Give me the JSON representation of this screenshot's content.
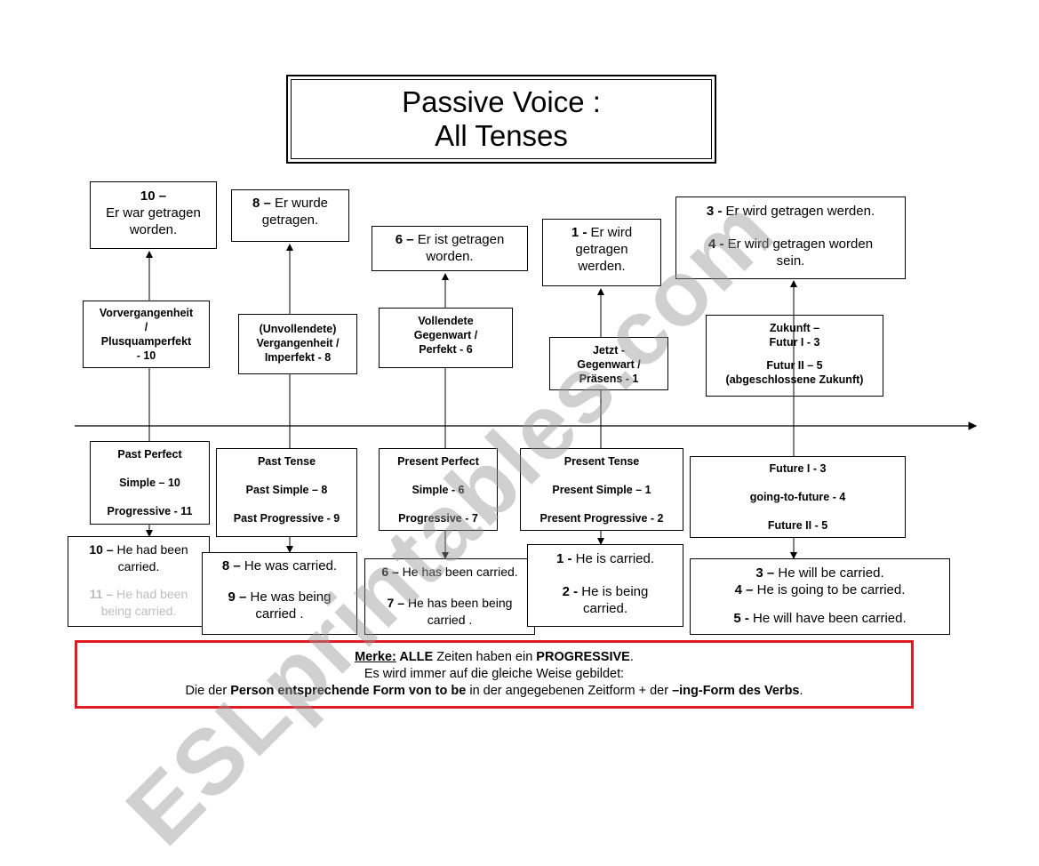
{
  "title": {
    "line1": "Passive Voice :",
    "line2": "All Tenses"
  },
  "german_examples": {
    "past_perfect": {
      "num": "10 –",
      "text1": "Er war getragen",
      "text2": "worden."
    },
    "past": {
      "num": "8 –",
      "text1": " Er wurde",
      "text2": "getragen."
    },
    "present_perfect": {
      "num": "6 –",
      "text1": " Er ist getragen",
      "text2": "worden."
    },
    "present": {
      "num": "1 -",
      "text1": " Er wird",
      "text2": "getragen",
      "text3": "werden."
    },
    "future": {
      "num1": "3 -",
      "text1": " Er wird getragen werden.",
      "num2": "4 -",
      "text2": " Er wird getragen worden",
      "text3": "sein."
    }
  },
  "german_tenses": {
    "past_perfect": [
      "Vorvergangenheit",
      "/",
      "Plusquamperfekt",
      "- 10"
    ],
    "past": [
      "(Unvollendete)",
      "Vergangenheit /",
      "Imperfekt - 8"
    ],
    "present_perfect": [
      "Vollendete",
      "Gegenwart /",
      "Perfekt - 6"
    ],
    "present": [
      "Jetzt  -",
      "Gegenwart /",
      "Präsens - 1"
    ],
    "future": [
      "Zukunft –",
      "Futur I  - 3",
      "Futur II – 5",
      "(abgeschlossene Zukunft)"
    ]
  },
  "english_tenses": {
    "past_perfect": [
      "Past Perfect",
      "Simple – 10",
      "Progressive - 11"
    ],
    "past": [
      "Past Tense",
      "Past Simple – 8",
      "Past Progressive - 9"
    ],
    "present_perfect": [
      "Present Perfect",
      "Simple - 6",
      "Progressive - 7"
    ],
    "present": [
      "Present Tense",
      "Present Simple – 1",
      "Present Progressive - 2"
    ],
    "future": [
      "Future I - 3",
      "going-to-future - 4",
      "Future II - 5"
    ]
  },
  "english_examples": {
    "past_perfect": {
      "num1": "10 –",
      "text1a": " He had been",
      "text1b": "carried.",
      "num2": "11 –",
      "text2a": " He had been",
      "text2b": "being carried."
    },
    "past": {
      "num1": "8 –",
      "text1": " He was carried.",
      "num2": "9 –",
      "text2a": " He was being",
      "text2b": "carried ."
    },
    "present_perfect": {
      "num1": "6 –",
      "text1": " He has been carried.",
      "num2": "7 –",
      "text2a": " He has been  being",
      "text2b": "carried ."
    },
    "present": {
      "num1": "1 -",
      "text1": " He is carried.",
      "num2": "2 -",
      "text2a": " He is being",
      "text2b": "carried."
    },
    "future": {
      "num1": "3 –",
      "text1": " He will be carried.",
      "num2": "4 –",
      "text2": " He is going to be carried.",
      "num3": "5 -",
      "text3": " He will have been  carried."
    }
  },
  "note": {
    "merke": "Merke:",
    "alle": " ALLE",
    "l1_mid": " Zeiten haben ein ",
    "progressive": " PROGRESSIVE",
    "l1_end": ".",
    "line2": "Es wird immer auf die gleiche Weise gebildet:",
    "l3_a": "Die der ",
    "l3_b": "Person entsprechende Form von to be",
    "l3_c": " in der angegebenen Zeitform + der ",
    "l3_d": "–ing-Form des Verbs",
    "l3_e": "."
  },
  "watermark": "ESLprintables.com",
  "colors": {
    "note_border": "#e01b24",
    "watermark": "#969696"
  }
}
